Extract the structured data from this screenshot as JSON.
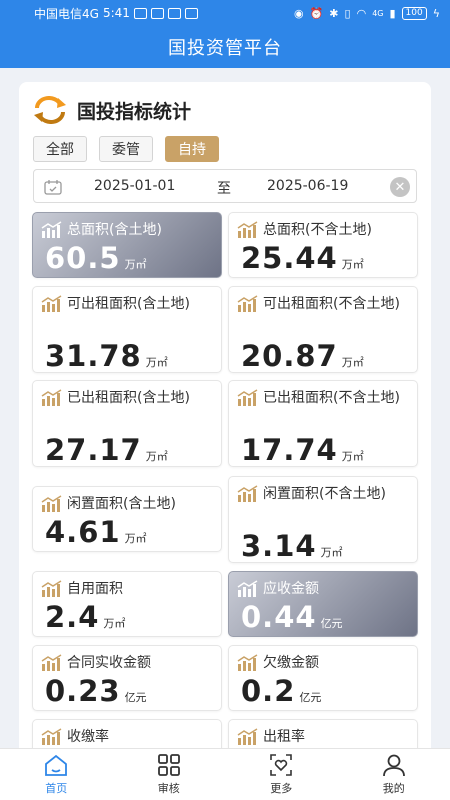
{
  "status_bar": {
    "carrier": "中国电信4G",
    "time": "5:41",
    "signal_tag": "4G",
    "battery": "100"
  },
  "header": {
    "title": "国投资管平台"
  },
  "card": {
    "title": "国投指标统计",
    "filters": [
      {
        "label": "全部",
        "active": false
      },
      {
        "label": "委管",
        "active": false
      },
      {
        "label": "自持",
        "active": true
      }
    ],
    "date_range": {
      "start": "2025-01-01",
      "separator": "至",
      "end": "2025-06-19"
    }
  },
  "stats": [
    {
      "label": "总面积(含土地)",
      "value": "60.5",
      "unit": "万㎡",
      "highlight": true
    },
    {
      "label": "总面积(不含土地)",
      "value": "25.44",
      "unit": "万㎡",
      "highlight": false
    },
    {
      "label": "可出租面积(含土地)",
      "value": "31.78",
      "unit": "万㎡",
      "highlight": false
    },
    {
      "label": "可出租面积(不含土地)",
      "value": "20.87",
      "unit": "万㎡",
      "highlight": false
    },
    {
      "label": "已出租面积(含土地)",
      "value": "27.17",
      "unit": "万㎡",
      "highlight": false
    },
    {
      "label": "已出租面积(不含土地)",
      "value": "17.74",
      "unit": "万㎡",
      "highlight": false
    },
    {
      "label": "闲置面积(含土地)",
      "value": "4.61",
      "unit": "万㎡",
      "highlight": false
    },
    {
      "label": "闲置面积(不含土地)",
      "value": "3.14",
      "unit": "万㎡",
      "highlight": false
    },
    {
      "label": "自用面积",
      "value": "2.4",
      "unit": "万㎡",
      "highlight": false
    },
    {
      "label": "应收金额",
      "value": "0.44",
      "unit": "亿元",
      "highlight": true
    },
    {
      "label": "合同实收金额",
      "value": "0.23",
      "unit": "亿元",
      "highlight": false
    },
    {
      "label": "欠缴金额",
      "value": "0.2",
      "unit": "亿元",
      "highlight": false
    },
    {
      "label": "收缴率",
      "value": "",
      "unit": "",
      "highlight": false
    },
    {
      "label": "出租率",
      "value": "",
      "unit": "",
      "highlight": false
    }
  ],
  "bottom_nav": [
    {
      "label": "首页",
      "icon": "home-icon",
      "active": true
    },
    {
      "label": "审核",
      "icon": "grid-icon",
      "active": false
    },
    {
      "label": "更多",
      "icon": "more-icon",
      "active": false
    },
    {
      "label": "我的",
      "icon": "profile-icon",
      "active": false
    }
  ],
  "colors": {
    "brand_blue": "#2e86e8",
    "gold": "#c9a267",
    "highlight_tile_dark": "#6e7386"
  }
}
